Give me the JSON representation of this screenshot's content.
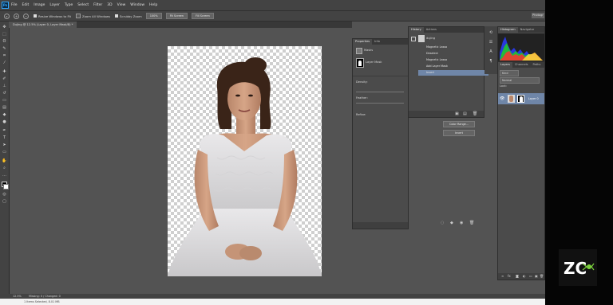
{
  "menubar": {
    "logo": "Ps",
    "items": [
      "File",
      "Edit",
      "Image",
      "Layer",
      "Type",
      "Select",
      "Filter",
      "3D",
      "View",
      "Window",
      "Help"
    ]
  },
  "options": {
    "resize_windows": "Resize Windows to Fit",
    "zoom_all": "Zoom All Windows",
    "scrubby_zoom": "Scrubby Zoom",
    "btn_100": "100%",
    "btn_fit": "Fit Screen",
    "btn_fill": "Fill Screen",
    "workspace": "Photogr"
  },
  "document": {
    "tab": "Dujing @ 12.5% (Layer 0, Layer Mask/8) *",
    "zoom": "12.5%",
    "status": "Missing: 0 / Changed: 0"
  },
  "properties": {
    "tabs": [
      "Properties",
      "Info"
    ],
    "masks": "Masks",
    "layer_mask": "Layer Mask",
    "density": "Density:",
    "feather": "Feather:",
    "refine": "Refine:",
    "color_range": "Color Range...",
    "invert": "Invert"
  },
  "history": {
    "tabs": [
      "History",
      "Actions"
    ],
    "snapshot": "dujing",
    "items": [
      "Magnetic Lasso",
      "Deselect",
      "Magnetic Lasso",
      "Add Layer Mask",
      "Invert"
    ],
    "selected_index": 4
  },
  "histogram": {
    "tabs": [
      "Histogram",
      "Navigator"
    ]
  },
  "layers": {
    "tabs": [
      "Layers",
      "Channels",
      "Paths"
    ],
    "kind": "Kind",
    "blend": "Normal",
    "lock": "Lock:",
    "layer_name": "Layer 0"
  },
  "bottom": {
    "text": "1 Items Selected, 8.01 MB"
  },
  "logo": {
    "text": "ZC"
  },
  "colors": {
    "ui_bg": "#535353",
    "panel": "#4b4b4b",
    "selection": "#6f86a8",
    "accent": "#31a8ff"
  }
}
